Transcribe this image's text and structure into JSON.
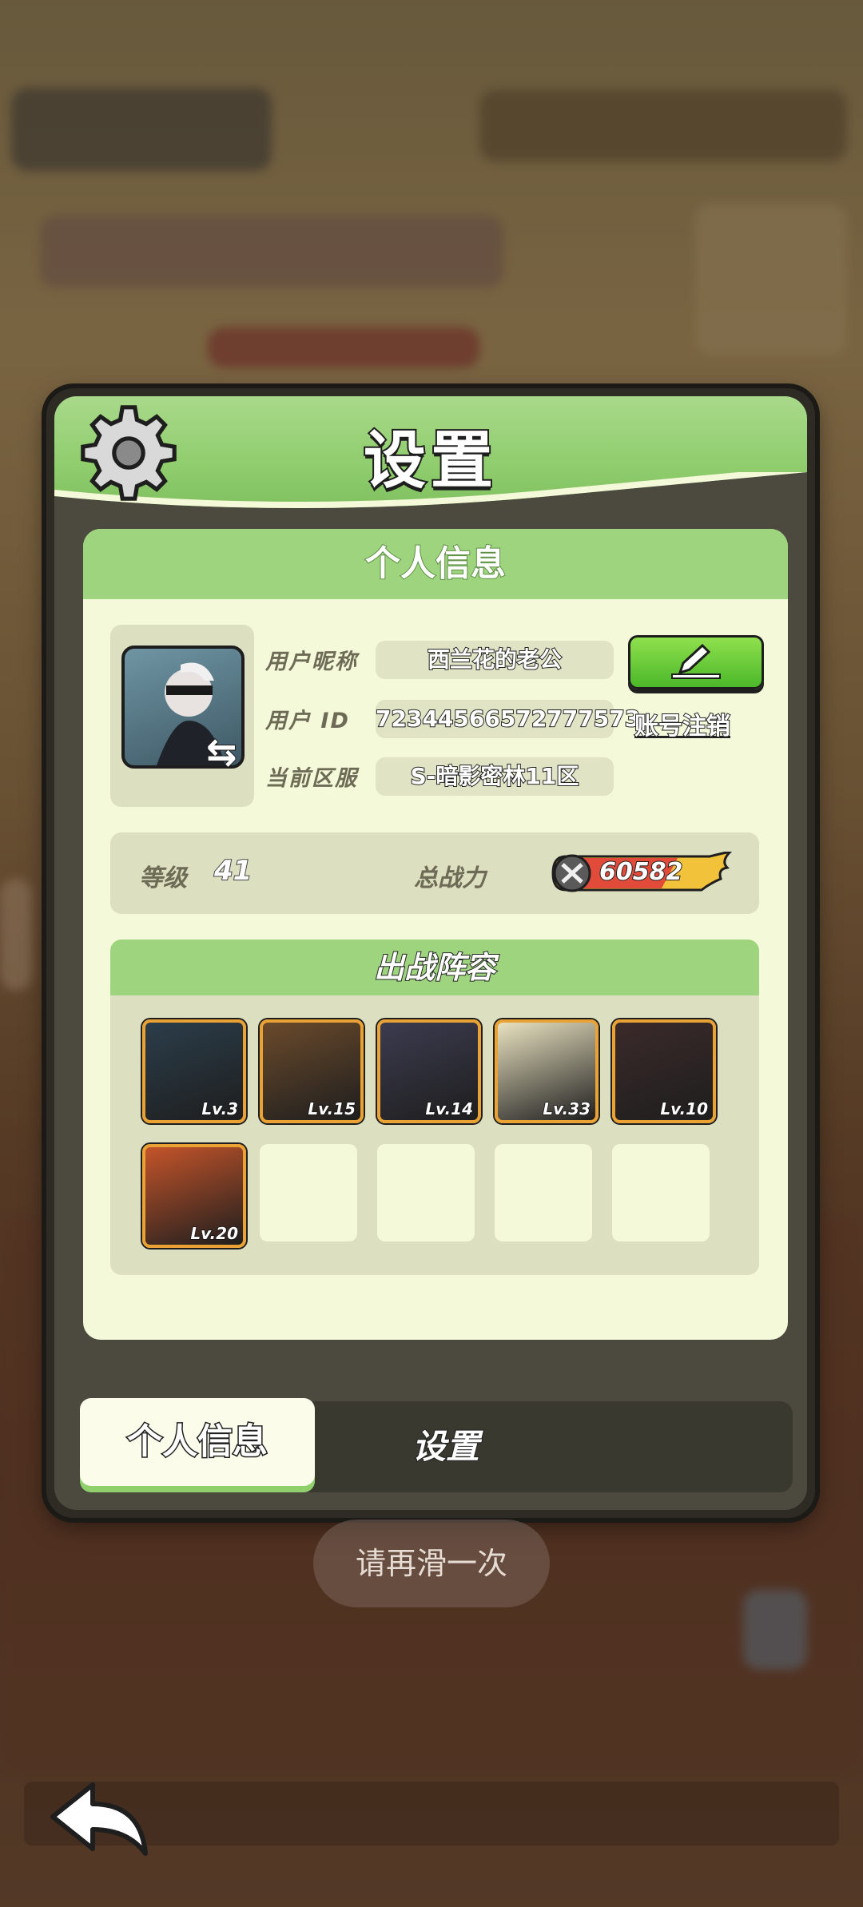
{
  "dialog": {
    "title": "设置",
    "section_title": "个人信息",
    "profile": {
      "nickname_label": "用户昵称",
      "nickname_value": "西兰花的老公",
      "id_label": "用户 ID",
      "id_value": "72344566572777573",
      "server_label": "当前区服",
      "server_value": "S-暗影密林11区",
      "logout_label": "账号注销"
    },
    "stats": {
      "level_label": "等级",
      "level_value": "41",
      "power_label": "总战力",
      "power_value": "60582"
    },
    "lineup": {
      "title": "出战阵容",
      "heroes": [
        {
          "lv": "Lv.3",
          "color": "#2b3d4a"
        },
        {
          "lv": "Lv.15",
          "color": "#6a4a2b"
        },
        {
          "lv": "Lv.14",
          "color": "#3c3b4f"
        },
        {
          "lv": "Lv.33",
          "color": "#e9e2c0"
        },
        {
          "lv": "Lv.10",
          "color": "#3b2a2a"
        },
        {
          "lv": "Lv.20",
          "color": "#c4542a"
        }
      ]
    },
    "tabs": {
      "active": "个人信息",
      "other": "设置"
    }
  },
  "toast": "请再滑一次"
}
